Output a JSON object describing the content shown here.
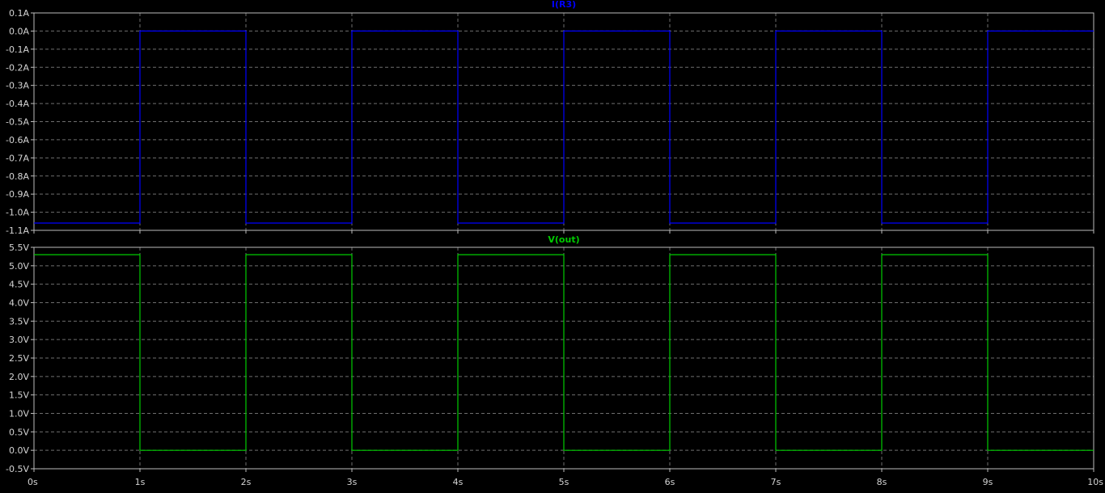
{
  "chart_data": [
    {
      "type": "line",
      "title": "I(R3)",
      "color": "#0000ff",
      "x_ticks": [
        "0s",
        "1s",
        "2s",
        "3s",
        "4s",
        "5s",
        "6s",
        "7s",
        "8s",
        "9s",
        "10s"
      ],
      "y_ticks": [
        "0.1A",
        "0.0A",
        "-0.1A",
        "-0.2A",
        "-0.3A",
        "-0.4A",
        "-0.5A",
        "-0.6A",
        "-0.7A",
        "-0.8A",
        "-0.9A",
        "-1.0A",
        "-1.1A"
      ],
      "xlim": [
        0,
        10
      ],
      "ylim": [
        -1.1,
        0.1
      ],
      "grid": true,
      "series": [
        {
          "name": "I(R3)",
          "x": [
            0,
            1,
            1,
            2,
            2,
            3,
            3,
            4,
            4,
            5,
            5,
            6,
            6,
            7,
            7,
            8,
            8,
            9,
            9,
            10
          ],
          "y": [
            -1.06,
            -1.06,
            0,
            0,
            -1.06,
            -1.06,
            0,
            0,
            -1.06,
            -1.06,
            0,
            0,
            -1.06,
            -1.06,
            0,
            0,
            -1.06,
            -1.06,
            0,
            0
          ]
        }
      ]
    },
    {
      "type": "line",
      "title": "V(out)",
      "color": "#00cc00",
      "x_ticks": [
        "0s",
        "1s",
        "2s",
        "3s",
        "4s",
        "5s",
        "6s",
        "7s",
        "8s",
        "9s",
        "10s"
      ],
      "y_ticks": [
        "5.5V",
        "5.0V",
        "4.5V",
        "4.0V",
        "3.5V",
        "3.0V",
        "2.5V",
        "2.0V",
        "1.5V",
        "1.0V",
        "0.5V",
        "0.0V",
        "-0.5V"
      ],
      "xlim": [
        0,
        10
      ],
      "ylim": [
        -0.5,
        5.5
      ],
      "grid": true,
      "series": [
        {
          "name": "V(out)",
          "x": [
            0,
            1,
            1,
            2,
            2,
            3,
            3,
            4,
            4,
            5,
            5,
            6,
            6,
            7,
            7,
            8,
            8,
            9,
            9,
            10
          ],
          "y": [
            5.3,
            5.3,
            0,
            0,
            5.3,
            5.3,
            0,
            0,
            5.3,
            5.3,
            0,
            0,
            5.3,
            5.3,
            0,
            0,
            5.3,
            5.3,
            0,
            0
          ]
        }
      ]
    }
  ]
}
